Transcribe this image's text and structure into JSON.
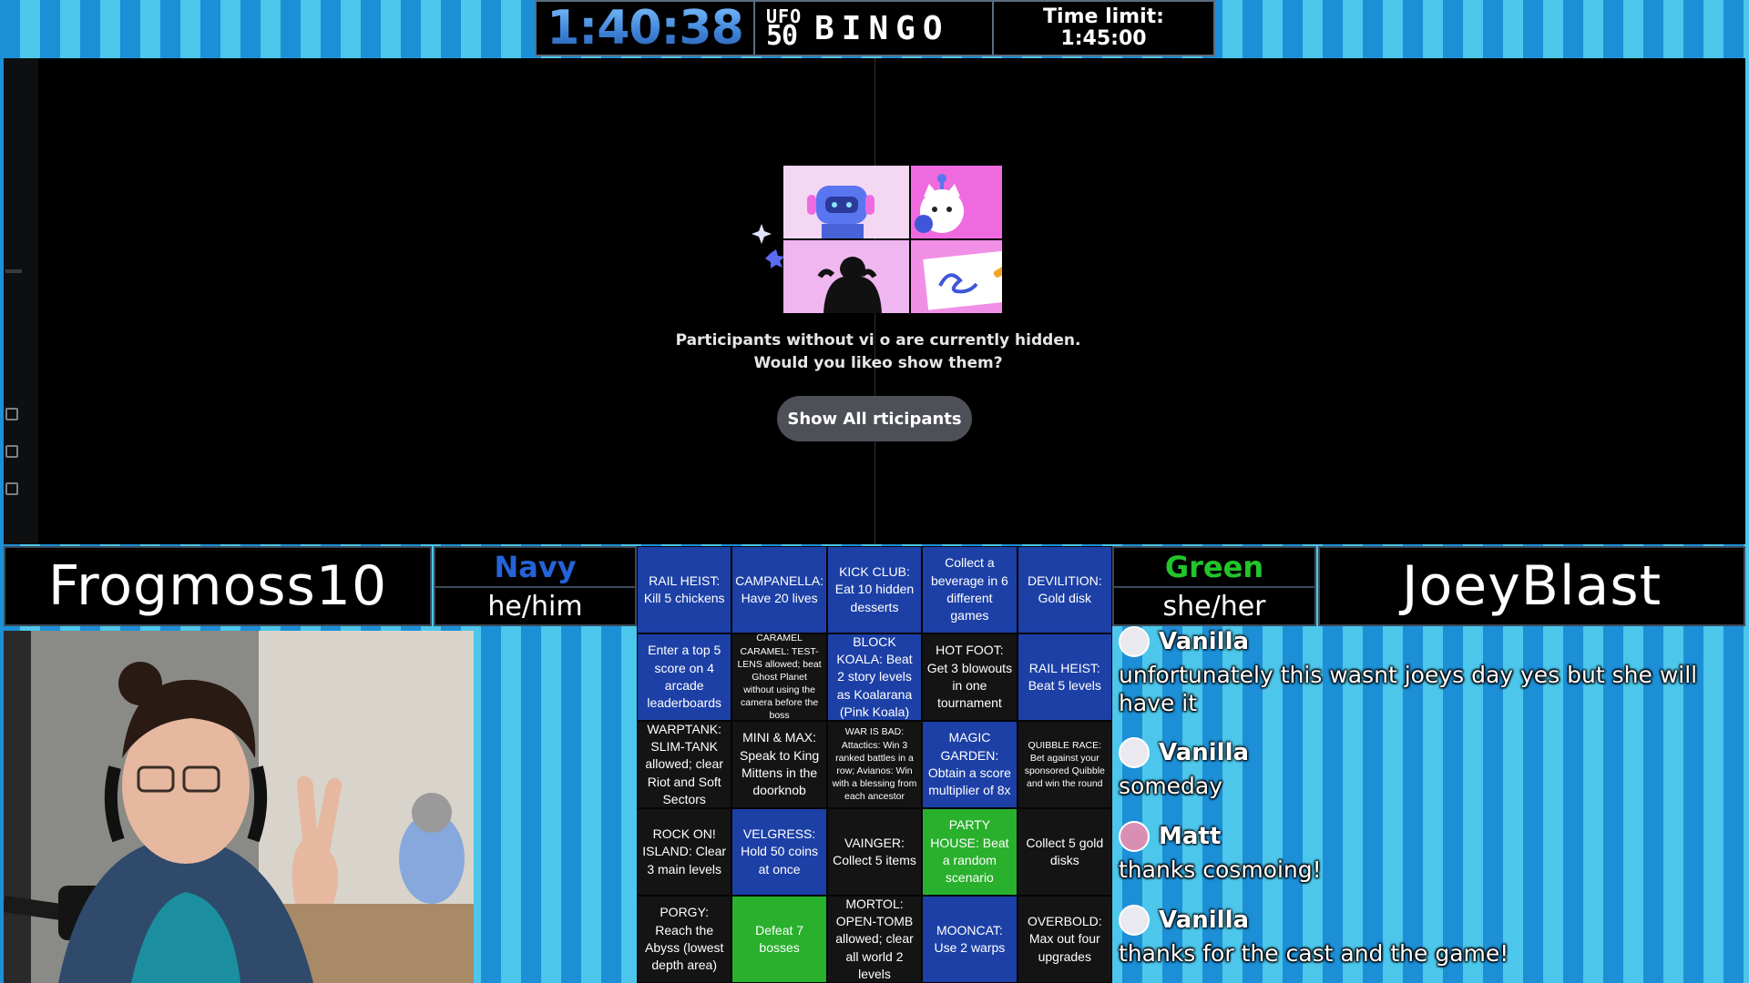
{
  "timer": {
    "elapsed": "1:40:38",
    "logo_ufo": "UFO",
    "logo_num": "50",
    "logo_bingo": "BINGO",
    "limit_label": "Time limit:",
    "limit_value": "1:45:00"
  },
  "call": {
    "hidden_line1": "Participants without vi o are currently hidden.",
    "hidden_line2": "Would you likeo show them?",
    "show_button": "Show All  rticipants"
  },
  "left_player": {
    "name": "Frogmoss10",
    "team": "Navy",
    "team_color": "#2563d8",
    "pronouns": "he/him"
  },
  "right_player": {
    "name": "JoeyBlast",
    "team": "Green",
    "team_color": "#22c52a",
    "pronouns": "she/her"
  },
  "colors": {
    "navy": "#1d40a6",
    "green": "#29b02c",
    "blank": "#141414"
  },
  "board": [
    {
      "text": "RAIL HEIST: Kill 5 chickens",
      "state": "navy"
    },
    {
      "text": "CAMPANELLA: Have 20 lives",
      "state": "navy"
    },
    {
      "text": "KICK CLUB: Eat 10 hidden desserts",
      "state": "navy"
    },
    {
      "text": "Collect a beverage in 6 different games",
      "state": "navy"
    },
    {
      "text": "DEVILITION: Gold disk",
      "state": "navy"
    },
    {
      "text": "Enter a top 5 score on 4 arcade leaderboards",
      "state": "navy"
    },
    {
      "text": "CARAMEL CARAMEL: TEST-LENS allowed; beat Ghost Planet without using the camera before the boss",
      "state": "blank",
      "small": true
    },
    {
      "text": "BLOCK KOALA: Beat 2 story levels as Koalarana (Pink Koala)",
      "state": "navy"
    },
    {
      "text": "HOT FOOT: Get 3 blowouts in one tournament",
      "state": "blank"
    },
    {
      "text": "RAIL HEIST: Beat 5 levels",
      "state": "navy"
    },
    {
      "text": "WARPTANK: SLIM-TANK allowed; clear Riot and Soft Sectors",
      "state": "blank"
    },
    {
      "text": "MINI & MAX: Speak to King Mittens in the doorknob",
      "state": "blank"
    },
    {
      "text": "WAR IS BAD: Attactics: Win 3 ranked battles in a row; Avianos: Win with a blessing from each ancestor",
      "state": "blank",
      "small": true
    },
    {
      "text": "MAGIC GARDEN: Obtain a score multiplier of 8x",
      "state": "navy"
    },
    {
      "text": "QUIBBLE RACE: Bet against your sponsored Quibble and win the round",
      "state": "blank",
      "small": true
    },
    {
      "text": "ROCK ON! ISLAND: Clear 3 main levels",
      "state": "blank"
    },
    {
      "text": "VELGRESS: Hold 50 coins at once",
      "state": "navy"
    },
    {
      "text": "VAINGER: Collect 5 items",
      "state": "blank"
    },
    {
      "text": "PARTY HOUSE: Beat a random scenario",
      "state": "green"
    },
    {
      "text": "Collect 5 gold disks",
      "state": "blank"
    },
    {
      "text": "PORGY: Reach the Abyss (lowest depth area)",
      "state": "blank"
    },
    {
      "text": "Defeat 7 bosses",
      "state": "green"
    },
    {
      "text": "MORTOL: OPEN-TOMB allowed; clear all world 2 levels",
      "state": "blank"
    },
    {
      "text": "MOONCAT: Use 2 warps",
      "state": "navy"
    },
    {
      "text": "OVERBOLD: Max out four upgrades",
      "state": "blank"
    }
  ],
  "chat": [
    {
      "user": "Vanilla",
      "text": "unfortunately this wasnt joeys day yes but she will have it",
      "avatar_color": "#e9e9ef"
    },
    {
      "user": "Vanilla",
      "text": "someday",
      "avatar_color": "#e9e9ef"
    },
    {
      "user": "Matt",
      "text": "thanks cosmoing!",
      "avatar_color": "#d98fb4"
    },
    {
      "user": "Vanilla",
      "text": "thanks for the cast and the game!",
      "avatar_color": "#e9e9ef"
    }
  ]
}
